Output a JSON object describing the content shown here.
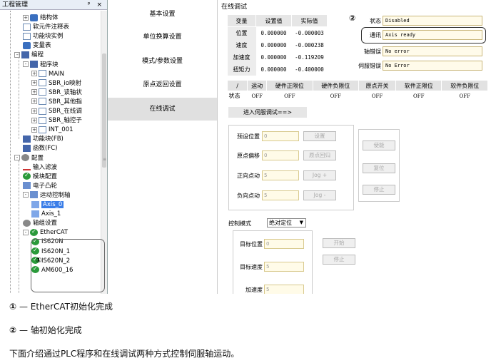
{
  "tree": {
    "title": "工程管理",
    "controls": "ᵖ ×",
    "items": [
      {
        "label": "结构体",
        "indent": 1
      },
      {
        "label": "软元件注释表",
        "indent": 1
      },
      {
        "label": "功能块实例",
        "indent": 1
      },
      {
        "label": "变量表",
        "indent": 1
      },
      {
        "label": "编程",
        "indent": 0
      },
      {
        "label": "程序块",
        "indent": 1
      },
      {
        "label": "MAIN",
        "indent": 2
      },
      {
        "label": "SBR_io映射",
        "indent": 2
      },
      {
        "label": "SBR_读轴状",
        "indent": 2
      },
      {
        "label": "SBR_其他指",
        "indent": 2
      },
      {
        "label": "SBR_在线调",
        "indent": 2
      },
      {
        "label": "SBR_轴控子",
        "indent": 2
      },
      {
        "label": "INT_001",
        "indent": 2
      },
      {
        "label": "功能块(FB)",
        "indent": 1
      },
      {
        "label": "函数(FC)",
        "indent": 1
      },
      {
        "label": "配置",
        "indent": 0
      },
      {
        "label": "输入滤波",
        "indent": 1
      },
      {
        "label": "模块配置",
        "indent": 1
      },
      {
        "label": "电子凸轮",
        "indent": 1
      },
      {
        "label": "运动控制轴",
        "indent": 1
      },
      {
        "label": "Axis_0",
        "indent": 2
      },
      {
        "label": "Axis_1",
        "indent": 2
      },
      {
        "label": "轴组设置",
        "indent": 1
      },
      {
        "label": "EtherCAT",
        "indent": 1
      },
      {
        "label": "IS620N",
        "indent": 2
      },
      {
        "label": "IS620N_1",
        "indent": 2
      },
      {
        "label": "IS620N_2",
        "indent": 2
      },
      {
        "label": "AM600_16",
        "indent": 2
      }
    ],
    "callout": "①"
  },
  "menu": {
    "items": [
      "基本设置",
      "单位换算设置",
      "模式/参数设置",
      "原点返回设置",
      "在线调试"
    ],
    "active": 4
  },
  "online": {
    "title": "在线调试",
    "table_headers": [
      "变量",
      "设置值",
      "实际值"
    ],
    "rows": [
      {
        "name": "位置",
        "set": "0.000000",
        "actual": "-0.000003"
      },
      {
        "name": "速度",
        "set": "0.000000",
        "actual": "-0.000238"
      },
      {
        "name": "加速度",
        "set": "0.000000",
        "actual": "-0.119209"
      },
      {
        "name": "扭矩力",
        "set": "0.000000",
        "actual": "-0.400000"
      }
    ],
    "callout": "②",
    "status": [
      {
        "label": "状态",
        "value": "Disabled"
      },
      {
        "label": "通讯",
        "value": "Axis ready"
      },
      {
        "label": "轴错误",
        "value": "No error"
      },
      {
        "label": "伺服错误",
        "value": "No Error"
      }
    ],
    "io_headers": [
      "/",
      "运动",
      "硬件正限位",
      "硬件负限位",
      "原点开关",
      "软件正限位",
      "软件负限位"
    ],
    "io_row_label": "状态",
    "io_values": [
      "OFF",
      "OFF",
      "OFF",
      "OFF",
      "OFF",
      "OFF"
    ],
    "enter_button": "进入伺服调试==>",
    "preset_label": "预设位置",
    "preset_value": "0",
    "set_button": "设置",
    "enable_button": "使能",
    "offset_label": "原点偏移",
    "offset_value": "0",
    "home_button": "原点回归",
    "reset_button": "复位",
    "jog_pos_label": "正向点动",
    "jog_pos_value": "5",
    "jog_pos_button": "Jog +",
    "stop_button": "停止",
    "jog_neg_label": "负向点动",
    "jog_neg_value": "5",
    "jog_neg_button": "Jog -",
    "mode_label": "控制模式",
    "mode_value": "绝对定位",
    "target_pos_label": "目标位置",
    "target_pos_value": "0",
    "start_button": "开始",
    "target_speed_label": "目标速度",
    "target_speed_value": "5",
    "stop2_button": "停止",
    "accel_label": "加速度",
    "accel_value": "5"
  },
  "captions": {
    "c1_num": "①",
    "c1_text": " — EtherCAT初始化完成",
    "c2_num": "②",
    "c2_text": " — 轴初始化完成",
    "c3_text": "下面介绍通过PLC程序和在线调试两种方式控制伺服轴运动。"
  }
}
